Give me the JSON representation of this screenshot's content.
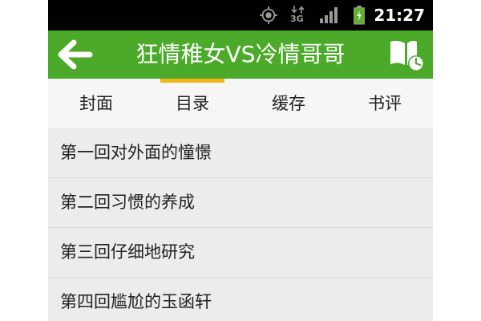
{
  "status_bar": {
    "time": "21:27",
    "network_label": "3G",
    "icons": [
      "gps-icon",
      "network-3g-icon",
      "signal-icon",
      "battery-icon"
    ]
  },
  "header": {
    "title": "狂情稚女VS冷情哥哥",
    "back_icon": "arrow-left-icon",
    "history_icon": "book-clock-icon",
    "color": "#4caa2a"
  },
  "tabs": [
    {
      "label": "封面"
    },
    {
      "label": "目录",
      "selected": true
    },
    {
      "label": "缓存"
    },
    {
      "label": "书评"
    }
  ],
  "tab_accent_color": "#f3b417",
  "chapters": [
    {
      "title": "第一回对外面的憧憬"
    },
    {
      "title": "第二回习惯的养成"
    },
    {
      "title": "第三回仔细地研究"
    },
    {
      "title": "第四回尴尬的玉函轩"
    }
  ]
}
